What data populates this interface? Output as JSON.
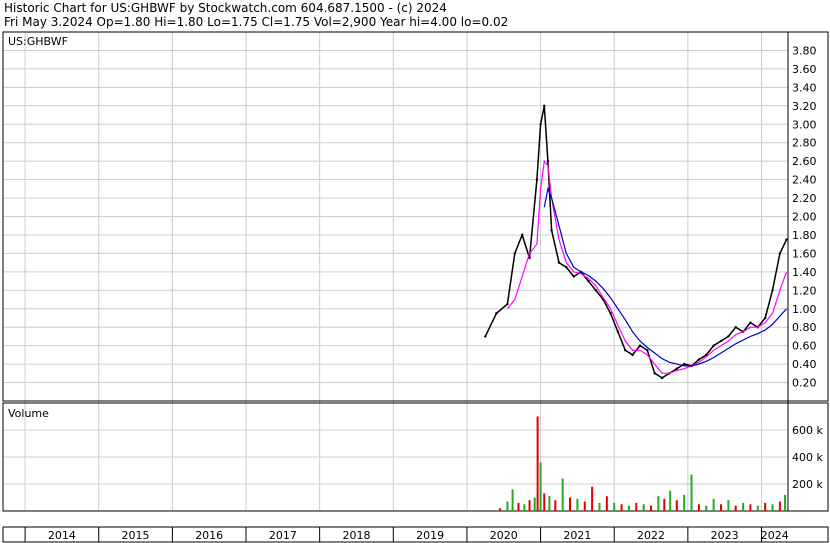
{
  "header": {
    "line1": "Historic Chart for US:GHBWF by Stockwatch.com 604.687.1500 - (c) 2024",
    "line2": "Fri May  3.2024  Op=1.80  Hi=1.80  Lo=1.75  Cl=1.75  Vol=2,900  Year hi=4.00  lo=0.02"
  },
  "chart_data": [
    {
      "type": "line",
      "title": "US:GHBWF",
      "ylim": [
        0,
        4.0
      ],
      "y_ticks": [
        "0.20",
        "0.40",
        "0.60",
        "0.80",
        "1.00",
        "1.20",
        "1.40",
        "1.60",
        "1.80",
        "2.00",
        "2.20",
        "2.40",
        "2.60",
        "2.80",
        "3.00",
        "3.20",
        "3.40",
        "3.60",
        "3.80"
      ],
      "x_labels": [
        "2014",
        "2015",
        "2016",
        "2017",
        "2018",
        "2019",
        "2020",
        "2021",
        "2022",
        "2023",
        "2024"
      ],
      "x": [
        2020.25,
        2020.4,
        2020.55,
        2020.65,
        2020.75,
        2020.85,
        2020.95,
        2021.0,
        2021.05,
        2021.1,
        2021.15,
        2021.25,
        2021.35,
        2021.45,
        2021.55,
        2021.65,
        2021.75,
        2021.85,
        2021.95,
        2022.05,
        2022.15,
        2022.25,
        2022.35,
        2022.45,
        2022.55,
        2022.65,
        2022.75,
        2022.85,
        2022.95,
        2023.05,
        2023.15,
        2023.25,
        2023.35,
        2023.45,
        2023.55,
        2023.65,
        2023.75,
        2023.85,
        2023.95,
        2024.05,
        2024.15,
        2024.25,
        2024.34
      ],
      "series": [
        {
          "name": "",
          "color": "#000000",
          "values": [
            0.7,
            0.95,
            1.05,
            1.6,
            1.8,
            1.55,
            2.4,
            3.0,
            3.2,
            2.6,
            1.85,
            1.5,
            1.45,
            1.35,
            1.4,
            1.3,
            1.2,
            1.1,
            0.95,
            0.75,
            0.55,
            0.5,
            0.6,
            0.55,
            0.3,
            0.25,
            0.3,
            0.35,
            0.4,
            0.38,
            0.45,
            0.5,
            0.6,
            0.65,
            0.7,
            0.8,
            0.75,
            0.85,
            0.8,
            0.9,
            1.2,
            1.6,
            1.75
          ]
        },
        {
          "color": "#ff00ff",
          "values": [
            null,
            null,
            1.0,
            1.1,
            1.35,
            1.6,
            1.7,
            2.3,
            2.6,
            2.55,
            2.2,
            1.75,
            1.5,
            1.4,
            1.38,
            1.33,
            1.25,
            1.12,
            1.0,
            0.82,
            0.65,
            0.55,
            0.55,
            0.5,
            0.4,
            0.3,
            0.3,
            0.33,
            0.35,
            0.38,
            0.42,
            0.48,
            0.55,
            0.6,
            0.65,
            0.72,
            0.75,
            0.8,
            0.8,
            0.85,
            0.95,
            1.2,
            1.4
          ]
        },
        {
          "color": "#0000cc",
          "values": [
            null,
            null,
            null,
            null,
            null,
            null,
            null,
            null,
            2.1,
            2.3,
            2.2,
            1.9,
            1.6,
            1.45,
            1.4,
            1.36,
            1.3,
            1.22,
            1.12,
            1.0,
            0.88,
            0.75,
            0.65,
            0.58,
            0.52,
            0.46,
            0.42,
            0.4,
            0.38,
            0.38,
            0.4,
            0.43,
            0.47,
            0.52,
            0.57,
            0.62,
            0.66,
            0.7,
            0.73,
            0.77,
            0.83,
            0.92,
            1.0
          ]
        }
      ]
    },
    {
      "type": "bar",
      "title": "Volume",
      "ylim": [
        0,
        800
      ],
      "y_ticks": [
        "200 k",
        "400 k",
        "600 k"
      ],
      "bars": [
        {
          "x": 2020.45,
          "value": 20,
          "color": "red"
        },
        {
          "x": 2020.55,
          "value": 70,
          "color": "green"
        },
        {
          "x": 2020.62,
          "value": 160,
          "color": "green"
        },
        {
          "x": 2020.7,
          "value": 60,
          "color": "red"
        },
        {
          "x": 2020.78,
          "value": 50,
          "color": "green"
        },
        {
          "x": 2020.85,
          "value": 80,
          "color": "red"
        },
        {
          "x": 2020.92,
          "value": 100,
          "color": "green"
        },
        {
          "x": 2020.96,
          "value": 700,
          "color": "red"
        },
        {
          "x": 2021.0,
          "value": 360,
          "color": "green"
        },
        {
          "x": 2021.05,
          "value": 130,
          "color": "red"
        },
        {
          "x": 2021.12,
          "value": 110,
          "color": "green"
        },
        {
          "x": 2021.2,
          "value": 80,
          "color": "red"
        },
        {
          "x": 2021.3,
          "value": 240,
          "color": "green"
        },
        {
          "x": 2021.4,
          "value": 100,
          "color": "red"
        },
        {
          "x": 2021.5,
          "value": 90,
          "color": "green"
        },
        {
          "x": 2021.6,
          "value": 70,
          "color": "red"
        },
        {
          "x": 2021.7,
          "value": 180,
          "color": "red"
        },
        {
          "x": 2021.8,
          "value": 60,
          "color": "green"
        },
        {
          "x": 2021.9,
          "value": 110,
          "color": "red"
        },
        {
          "x": 2022.0,
          "value": 60,
          "color": "green"
        },
        {
          "x": 2022.1,
          "value": 50,
          "color": "red"
        },
        {
          "x": 2022.2,
          "value": 40,
          "color": "green"
        },
        {
          "x": 2022.3,
          "value": 60,
          "color": "red"
        },
        {
          "x": 2022.4,
          "value": 50,
          "color": "green"
        },
        {
          "x": 2022.5,
          "value": 40,
          "color": "red"
        },
        {
          "x": 2022.6,
          "value": 110,
          "color": "green"
        },
        {
          "x": 2022.68,
          "value": 90,
          "color": "red"
        },
        {
          "x": 2022.76,
          "value": 150,
          "color": "green"
        },
        {
          "x": 2022.85,
          "value": 80,
          "color": "red"
        },
        {
          "x": 2022.95,
          "value": 120,
          "color": "green"
        },
        {
          "x": 2023.05,
          "value": 270,
          "color": "green"
        },
        {
          "x": 2023.15,
          "value": 50,
          "color": "red"
        },
        {
          "x": 2023.25,
          "value": 40,
          "color": "green"
        },
        {
          "x": 2023.35,
          "value": 90,
          "color": "green"
        },
        {
          "x": 2023.45,
          "value": 50,
          "color": "red"
        },
        {
          "x": 2023.55,
          "value": 80,
          "color": "green"
        },
        {
          "x": 2023.65,
          "value": 40,
          "color": "red"
        },
        {
          "x": 2023.75,
          "value": 60,
          "color": "green"
        },
        {
          "x": 2023.85,
          "value": 50,
          "color": "red"
        },
        {
          "x": 2023.95,
          "value": 40,
          "color": "green"
        },
        {
          "x": 2024.05,
          "value": 60,
          "color": "red"
        },
        {
          "x": 2024.15,
          "value": 50,
          "color": "green"
        },
        {
          "x": 2024.25,
          "value": 70,
          "color": "red"
        },
        {
          "x": 2024.32,
          "value": 120,
          "color": "green"
        }
      ]
    }
  ]
}
